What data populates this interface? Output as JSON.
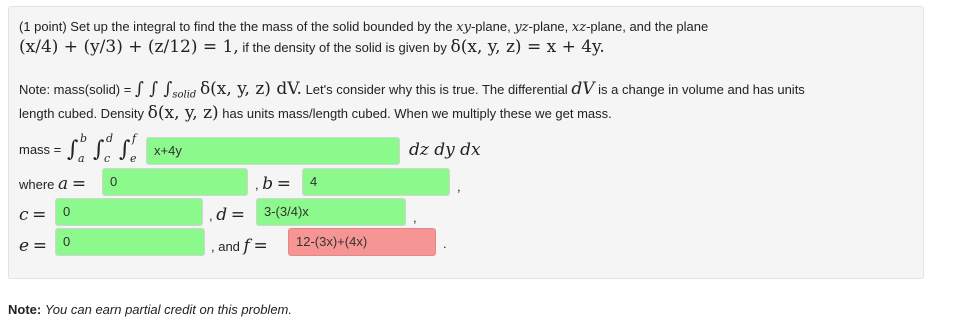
{
  "problem": {
    "intro_prefix": "(1 point) Set up the integral to find the the mass of the solid bounded by the",
    "plane_xy": "xy",
    "plane_xy_suffix": "-plane,",
    "plane_yz": "yz",
    "plane_yz_suffix": "-plane,",
    "plane_xz": "xz",
    "plane_xz_suffix": "-plane, and the plane",
    "plane_equation": "(x/4) + (y/3) + (z/12) = 1,",
    "density_prefix": "if the density of the solid is given by",
    "density_function": "δ(x, y, z) = x + 4y.",
    "note_line1_prefix": "Note: mass(solid) =",
    "note_integral": "∫ ∫ ∫",
    "note_integral_sub": "solid",
    "note_integrand": "δ(x, y, z) dV.",
    "note_line1_suffix": "Let's consider why this is true. The differential",
    "note_dv": "dV",
    "note_line1_end": "is a change in volume and has units",
    "note_line2_prefix": "length cubed. Density",
    "note_density": "δ(x, y, z)",
    "note_line2_suffix": "has units mass/length cubed. When we multiply these we get mass.",
    "mass_label": "mass =",
    "integral_sign": "∫",
    "limit_b": "b",
    "limit_a": "a",
    "limit_d": "d",
    "limit_c": "c",
    "limit_f": "f",
    "limit_e": "e",
    "differentials": "dz dy dx",
    "where_label": "where",
    "var_a": "a",
    "var_b": "b",
    "var_c": "c",
    "var_d": "d",
    "var_e": "e",
    "var_f": "f",
    "equals": "=",
    "comma": ",",
    "and_label": ", and",
    "period": "."
  },
  "answers": {
    "integrand": "x+4y",
    "a": "0",
    "b": "4",
    "c": "0",
    "d": "3-(3/4)x",
    "e": "0",
    "f": "12-(3x)+(4x)"
  },
  "status_colors": {
    "correct": "#8bf98b",
    "incorrect": "#f79595"
  },
  "footer": {
    "note_label": "Note:",
    "note_text": "You can earn partial credit on this problem."
  }
}
